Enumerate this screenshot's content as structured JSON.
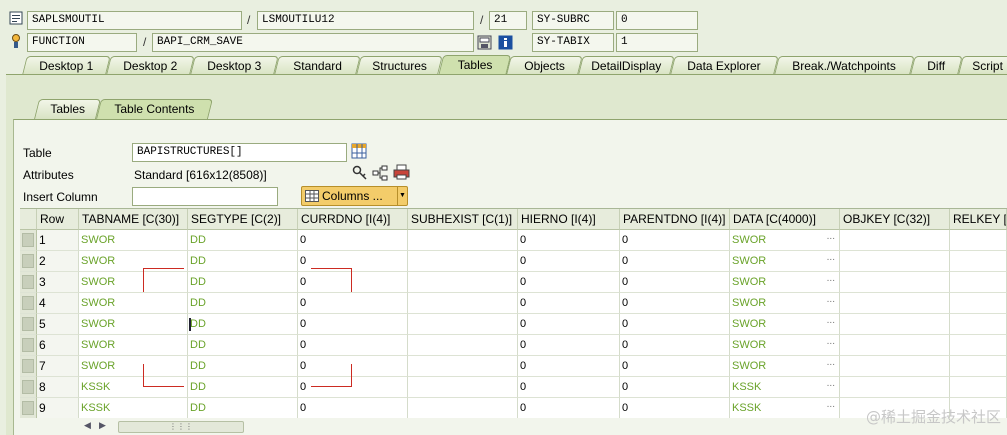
{
  "header": {
    "program": "SAPLSMOUTIL",
    "include": "LSMOUTILU12",
    "line": "21",
    "event_type": "FUNCTION",
    "event": "BAPI_CRM_SAVE",
    "sysvars": [
      {
        "name": "SY-SUBRC",
        "value": "0"
      },
      {
        "name": "SY-TABIX",
        "value": "1"
      }
    ]
  },
  "tabs": [
    {
      "label": "Desktop 1"
    },
    {
      "label": "Desktop 2"
    },
    {
      "label": "Desktop 3"
    },
    {
      "label": "Standard"
    },
    {
      "label": "Structures"
    },
    {
      "label": "Tables"
    },
    {
      "label": "Objects"
    },
    {
      "label": "DetailDisplay"
    },
    {
      "label": "Data Explorer"
    },
    {
      "label": "Break./Watchpoints"
    },
    {
      "label": "Diff"
    },
    {
      "label": "Script"
    }
  ],
  "active_tab": "Tables",
  "subtabs": [
    {
      "label": "Tables"
    },
    {
      "label": "Table Contents"
    }
  ],
  "active_subtab": "Table Contents",
  "form": {
    "table_label": "Table",
    "table_value": "BAPISTRUCTURES[]",
    "attributes_label": "Attributes",
    "attributes_value": "Standard [616x12(8508)]",
    "insert_label": "Insert Column",
    "insert_value": "",
    "columns_button": "Columns ..."
  },
  "grid": {
    "columns": [
      "Row",
      "TABNAME [C(30)]",
      "SEGTYPE [C(2)]",
      "CURRDNO [I(4)]",
      "SUBHEXIST [C(1)]",
      "HIERNO [I(4)]",
      "PARENTDNO [I(4)]",
      "DATA [C(4000)]",
      "OBJKEY [C(32)]",
      "RELKEY [C"
    ],
    "rows": [
      {
        "row": "1",
        "tabname": "SWOR",
        "segtype": "DD",
        "currdno": "0",
        "subhexist": "",
        "hierno": "0",
        "parentdno": "0",
        "data": "SWOR",
        "objkey": "",
        "relkey": ""
      },
      {
        "row": "2",
        "tabname": "SWOR",
        "segtype": "DD",
        "currdno": "0",
        "subhexist": "",
        "hierno": "0",
        "parentdno": "0",
        "data": "SWOR",
        "objkey": "",
        "relkey": ""
      },
      {
        "row": "3",
        "tabname": "SWOR",
        "segtype": "DD",
        "currdno": "0",
        "subhexist": "",
        "hierno": "0",
        "parentdno": "0",
        "data": "SWOR",
        "objkey": "",
        "relkey": ""
      },
      {
        "row": "4",
        "tabname": "SWOR",
        "segtype": "DD",
        "currdno": "0",
        "subhexist": "",
        "hierno": "0",
        "parentdno": "0",
        "data": "SWOR",
        "objkey": "",
        "relkey": ""
      },
      {
        "row": "5",
        "tabname": "SWOR",
        "segtype": "DD",
        "currdno": "0",
        "subhexist": "",
        "hierno": "0",
        "parentdno": "0",
        "data": "SWOR",
        "objkey": "",
        "relkey": ""
      },
      {
        "row": "6",
        "tabname": "SWOR",
        "segtype": "DD",
        "currdno": "0",
        "subhexist": "",
        "hierno": "0",
        "parentdno": "0",
        "data": "SWOR",
        "objkey": "",
        "relkey": ""
      },
      {
        "row": "7",
        "tabname": "SWOR",
        "segtype": "DD",
        "currdno": "0",
        "subhexist": "",
        "hierno": "0",
        "parentdno": "0",
        "data": "SWOR",
        "objkey": "",
        "relkey": ""
      },
      {
        "row": "8",
        "tabname": "KSSK",
        "segtype": "DD",
        "currdno": "0",
        "subhexist": "",
        "hierno": "0",
        "parentdno": "0",
        "data": "KSSK",
        "objkey": "",
        "relkey": ""
      },
      {
        "row": "9",
        "tabname": "KSSK",
        "segtype": "DD",
        "currdno": "0",
        "subhexist": "",
        "hierno": "0",
        "parentdno": "0",
        "data": "KSSK",
        "objkey": "",
        "relkey": ""
      }
    ]
  },
  "watermark": "@稀土掘金技术社区",
  "colors": {
    "value_green": "#6aa32a",
    "highlight_red": "#cc2b22",
    "tab_active": "#cfe0ae"
  }
}
